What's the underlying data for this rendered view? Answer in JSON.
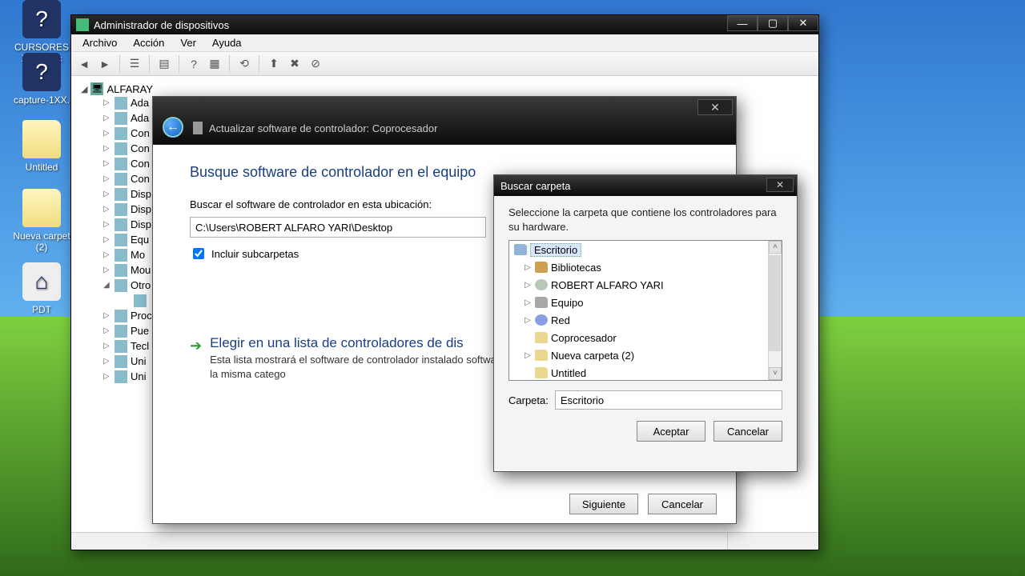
{
  "desktop": [
    {
      "label": "CURSORES X.camrec",
      "cls": "q"
    },
    {
      "label": "capture-1XX.",
      "cls": "q"
    },
    {
      "label": "Untitled",
      "cls": "folder"
    },
    {
      "label": "Nueva carpet (2)",
      "cls": "folder"
    },
    {
      "label": "PDT",
      "cls": "house"
    }
  ],
  "devmgr": {
    "title": "Administrador de dispositivos",
    "menus": [
      "Archivo",
      "Acción",
      "Ver",
      "Ayuda"
    ],
    "root": "ALFARAY",
    "items": [
      "Ada",
      "Ada",
      "Con",
      "Con",
      "Con",
      "Con",
      "Disp",
      "Disp",
      "Disp",
      "Equ",
      "Mo",
      "Mou",
      "Otro",
      "",
      "Proc",
      "Pue",
      "Tecl",
      "Uni",
      "Uni"
    ]
  },
  "wizard": {
    "title": "Actualizar software de controlador: Coprocesador",
    "heading": "Busque software de controlador en el equipo",
    "path_label": "Buscar el software de controlador en esta ubicación:",
    "path": "C:\\Users\\ROBERT ALFARO YARI\\Desktop",
    "include": "Incluir subcarpetas",
    "opt2_title": "Elegir en una lista de controladores de dis",
    "opt2_desc": "Esta lista mostrará el software de controlador instalado\nsoftware de controlador que esté en la misma catego",
    "next": "Siguiente",
    "cancel": "Cancelar"
  },
  "browse": {
    "title": "Buscar carpeta",
    "msg": "Seleccione la carpeta que contiene los controladores para su hardware.",
    "tree": [
      {
        "label": "Escritorio",
        "sel": true,
        "ic": "desk",
        "pm": ""
      },
      {
        "label": "Bibliotecas",
        "ic": "lib",
        "pm": "▷"
      },
      {
        "label": "ROBERT ALFARO YARI",
        "ic": "user",
        "pm": "▷"
      },
      {
        "label": "Equipo",
        "ic": "pc",
        "pm": "▷"
      },
      {
        "label": "Red",
        "ic": "net",
        "pm": "▷"
      },
      {
        "label": "Coprocesador",
        "ic": "fold",
        "pm": ""
      },
      {
        "label": "Nueva carpeta (2)",
        "ic": "fold",
        "pm": "▷"
      },
      {
        "label": "Untitled",
        "ic": "fold",
        "pm": ""
      }
    ],
    "folder_label": "Carpeta:",
    "folder_value": "Escritorio",
    "ok": "Aceptar",
    "cancel": "Cancelar"
  }
}
